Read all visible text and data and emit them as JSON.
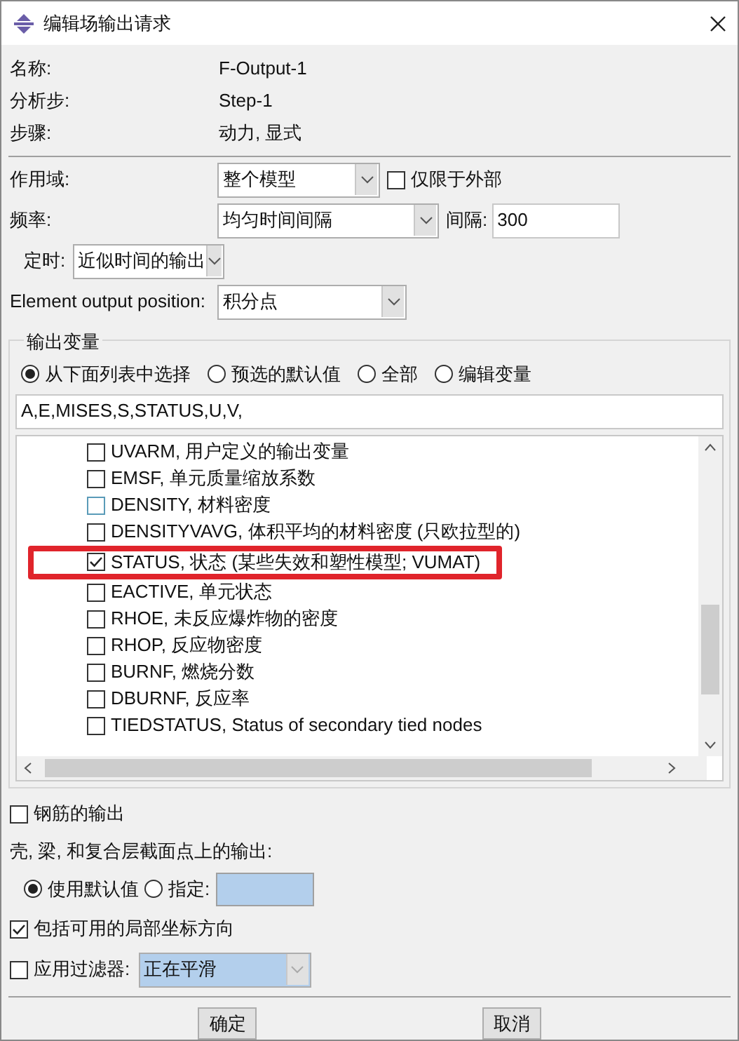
{
  "window": {
    "title": "编辑场输出请求"
  },
  "info": [
    {
      "label": "名称:",
      "value": "F-Output-1"
    },
    {
      "label": "分析步:",
      "value": "Step-1"
    },
    {
      "label": "步骤:",
      "value": "动力, 显式"
    }
  ],
  "domain": {
    "label": "作用域:",
    "value": "整个模型",
    "exterior": {
      "label": "仅限于外部",
      "checked": false
    }
  },
  "frequency": {
    "label": "频率:",
    "value": "均匀时间间隔",
    "interval_label": "间隔:",
    "interval": "300"
  },
  "timing": {
    "label": "定时:",
    "value": "近似时间的输出"
  },
  "position": {
    "label": "Element output position:",
    "value": "积分点"
  },
  "output_variables": {
    "title": "输出变量",
    "modes": [
      {
        "label": "从下面列表中选择",
        "selected": true
      },
      {
        "label": "预选的默认值",
        "selected": false
      },
      {
        "label": "全部",
        "selected": false
      },
      {
        "label": "编辑变量",
        "selected": false
      }
    ],
    "text": "A,E,MISES,S,STATUS,U,V,",
    "items": [
      {
        "label": "UVARM, 用户定义的输出变量",
        "checked": false,
        "hovered": false,
        "highlighted": false
      },
      {
        "label": "EMSF, 单元质量缩放系数",
        "checked": false,
        "hovered": false,
        "highlighted": false
      },
      {
        "label": "DENSITY, 材料密度",
        "checked": false,
        "hovered": true,
        "highlighted": false
      },
      {
        "label": "DENSITYVAVG, 体积平均的材料密度 (只欧拉型的)",
        "checked": false,
        "hovered": false,
        "highlighted": false
      },
      {
        "label": "STATUS, 状态 (某些失效和塑性模型; VUMAT)",
        "checked": true,
        "hovered": false,
        "highlighted": true
      },
      {
        "label": "EACTIVE, 单元状态",
        "checked": false,
        "hovered": false,
        "highlighted": false
      },
      {
        "label": "RHOE, 未反应爆炸物的密度",
        "checked": false,
        "hovered": false,
        "highlighted": false
      },
      {
        "label": "RHOP, 反应物密度",
        "checked": false,
        "hovered": false,
        "highlighted": false
      },
      {
        "label": "BURNF, 燃烧分数",
        "checked": false,
        "hovered": false,
        "highlighted": false
      },
      {
        "label": "DBURNF, 反应率",
        "checked": false,
        "hovered": false,
        "highlighted": false
      },
      {
        "label": "TIEDSTATUS, Status of secondary tied nodes",
        "checked": false,
        "hovered": false,
        "highlighted": false
      }
    ]
  },
  "rebar": {
    "label": "钢筋的输出",
    "checked": false
  },
  "section_points": {
    "label": "壳, 梁, 和复合层截面点上的输出:",
    "options": [
      {
        "label": "使用默认值",
        "selected": true
      },
      {
        "label": "指定:",
        "selected": false
      }
    ]
  },
  "local_coords": {
    "label": "包括可用的局部坐标方向",
    "checked": true
  },
  "filter": {
    "label": "应用过滤器:",
    "checked": false,
    "value": "正在平滑"
  },
  "buttons": [
    "确定",
    "取消"
  ]
}
